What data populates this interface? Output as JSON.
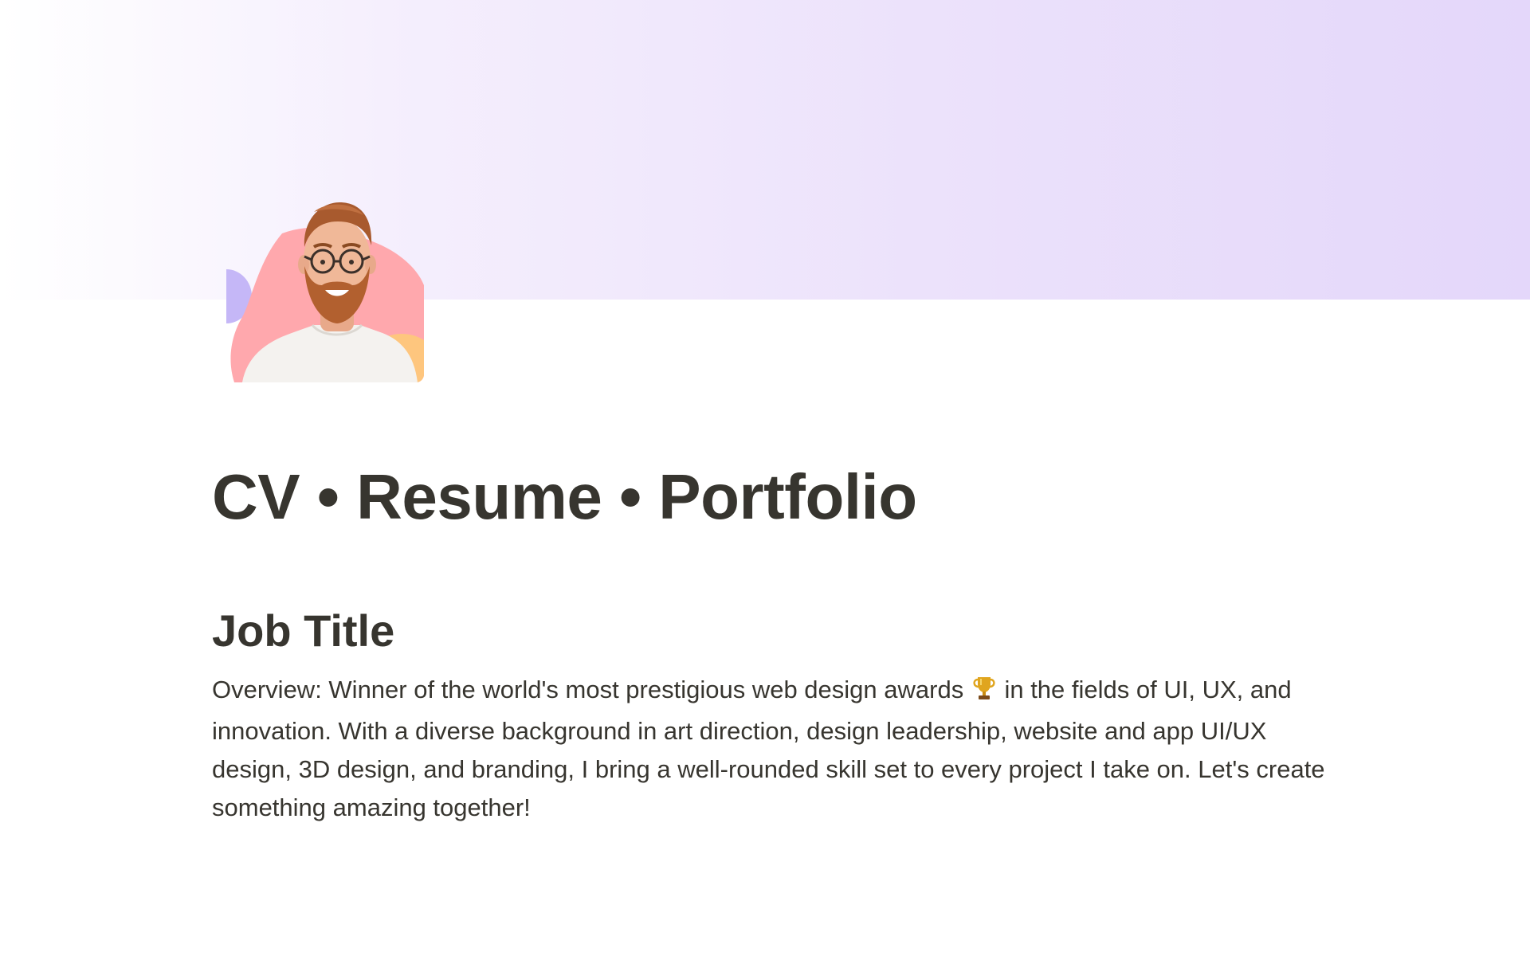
{
  "page": {
    "title": "CV • Resume • Portfolio",
    "cover": {
      "gradient_colors": [
        "#ffffff",
        "#f5effd",
        "#ece2fb",
        "#e4d7fa"
      ]
    },
    "icon": {
      "name": "profile-avatar",
      "blob_colors": {
        "pink": "#ffa8ad",
        "purple": "#c5b7f7",
        "orange": "#fec67e"
      }
    }
  },
  "section": {
    "heading": "Job Title",
    "overview_before_icon": "Overview: Winner of the world's most prestigious web design awards",
    "overview_icon": "trophy-icon",
    "overview_after_icon": "in the fields of UI, UX, and innovation. With a diverse background in art direction, design leadership, website and app UI/UX design, 3D design, and branding, I bring a well-rounded skill set to every project I take on. Let's create something amazing together!"
  }
}
